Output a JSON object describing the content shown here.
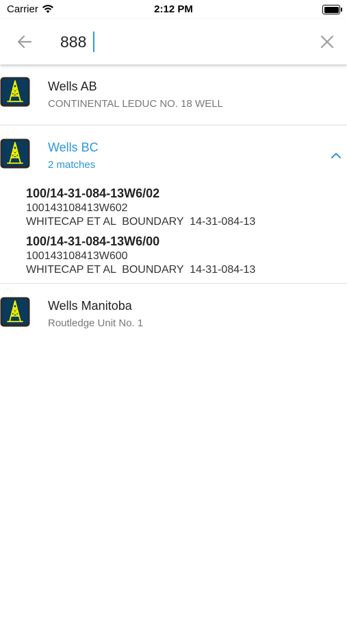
{
  "status_bar": {
    "carrier": "Carrier",
    "time": "2:12 PM"
  },
  "search": {
    "query": "888"
  },
  "groups": [
    {
      "title": "Wells AB",
      "subtitle": "CONTINENTAL LEDUC NO. 18 WELL",
      "expanded": false
    },
    {
      "title": "Wells BC",
      "subtitle": "2 matches",
      "expanded": true,
      "matches": [
        {
          "title": "100/14-31-084-13W6/02",
          "id": "100143108413W602",
          "name": "WHITECAP ET AL  BOUNDARY  14-31-084-13"
        },
        {
          "title": "100/14-31-084-13W6/00",
          "id": "100143108413W600",
          "name": "WHITECAP ET AL  BOUNDARY  14-31-084-13"
        }
      ]
    },
    {
      "title": "Wells Manitoba",
      "subtitle": "Routledge Unit No. 1",
      "expanded": false
    }
  ],
  "icons": {
    "back": "arrow-left-icon",
    "clear": "close-icon",
    "group": "oil-derrick-icon",
    "expand": "chevron-up-icon"
  },
  "colors": {
    "accent": "#2a96d8",
    "icon_bg": "#0b3a5a",
    "icon_fg": "#f2f200"
  }
}
